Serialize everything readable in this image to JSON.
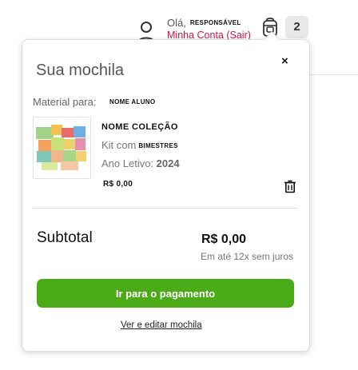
{
  "header": {
    "greeting": "Olá,",
    "user_role": "RESPONSÁVEL",
    "account_link": "Minha Conta (Sair)",
    "cart_count": "2",
    "accent_color": "#c8174a"
  },
  "popup": {
    "title": "Sua mochila",
    "close_symbol": "×",
    "material_label": "Material para:",
    "student_name": "NOME ALUNO",
    "item": {
      "collection_name": "NOME COLEÇÃO",
      "kit_label": "Kit com",
      "kit_value": "BIMESTRES",
      "year_label": "Ano Letivo:",
      "year_value": "2024",
      "price": "R$ 0,00"
    },
    "subtotal_label": "Subtotal",
    "subtotal_value": "R$ 0,00",
    "installments": "Em até 12x sem juros",
    "pay_button": "Ir para o pagamento",
    "pay_button_color": "#4aaa18",
    "edit_link": "Ver e editar mochila"
  },
  "icons": [
    "user-icon",
    "backpack-icon",
    "close-icon",
    "trash-icon"
  ]
}
